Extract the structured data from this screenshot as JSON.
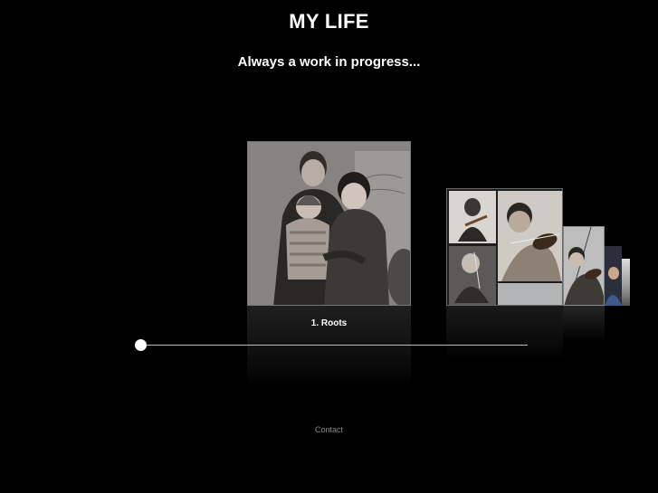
{
  "header": {
    "title": "MY LIFE",
    "tagline": "Always a work in progress..."
  },
  "gallery": {
    "items": [
      {
        "label": "1. Roots",
        "description": "family photo",
        "active": true
      },
      {
        "description": "collage of a boy playing violin"
      },
      {
        "description": "boy with violin"
      },
      {
        "description": "portrait photo"
      },
      {
        "description": "photo"
      }
    ],
    "slider": {
      "position": 0
    }
  },
  "footer": {
    "contact_label": "Contact"
  },
  "colors": {
    "background": "#000000",
    "text": "#ffffff",
    "footer_link": "#8a8a8a",
    "slider_track": "#bdbdbd"
  }
}
